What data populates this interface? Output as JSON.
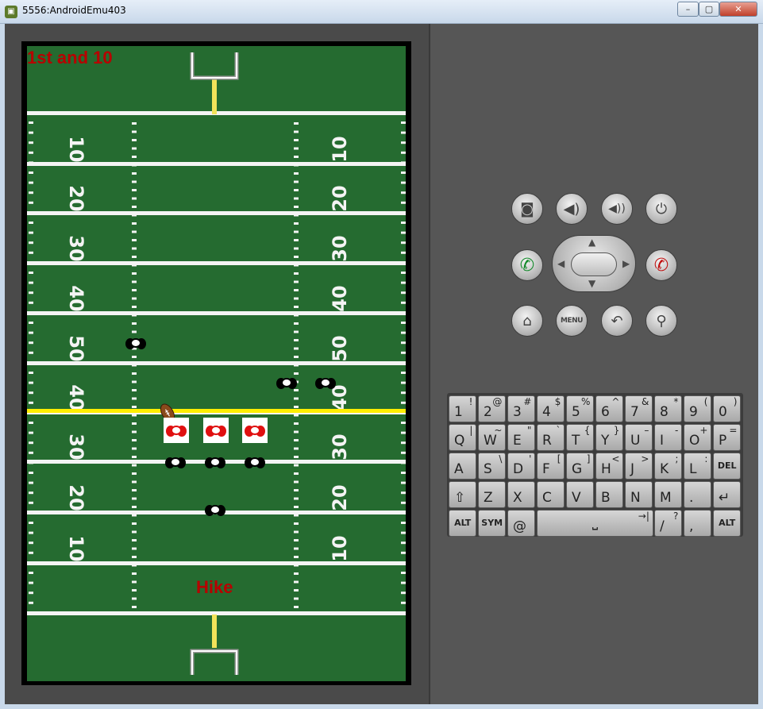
{
  "window": {
    "title": "5556:AndroidEmu403",
    "minimize": "–",
    "maximize": "▢",
    "close": "✕"
  },
  "game": {
    "down_text": "1st and 10",
    "hike_label": "Hike",
    "yard_numbers_left": [
      "10",
      "20",
      "30",
      "40",
      "50",
      "40",
      "30",
      "20",
      "10"
    ],
    "yard_numbers_right": [
      "10",
      "20",
      "30",
      "40",
      "50",
      "40",
      "30",
      "20",
      "10"
    ]
  },
  "hardware": {
    "camera": "camera-icon",
    "volume_down": "volume-down-icon",
    "volume_up": "volume-up-icon",
    "power": "power-icon",
    "call": "call-icon",
    "end_call": "end-call-icon",
    "home": "home-icon",
    "menu_label": "MENU",
    "back": "back-icon",
    "search": "search-icon"
  },
  "keyboard": {
    "rows": [
      [
        [
          "1",
          "!"
        ],
        [
          "2",
          "@"
        ],
        [
          "3",
          "#"
        ],
        [
          "4",
          "$"
        ],
        [
          "5",
          "%"
        ],
        [
          "6",
          "^"
        ],
        [
          "7",
          "&"
        ],
        [
          "8",
          "*"
        ],
        [
          "9",
          "("
        ],
        [
          "0",
          ")"
        ]
      ],
      [
        [
          "Q",
          "|"
        ],
        [
          "W",
          "~"
        ],
        [
          "E",
          "\""
        ],
        [
          "R",
          "`"
        ],
        [
          "T",
          "{"
        ],
        [
          "Y",
          "}"
        ],
        [
          "U",
          "–"
        ],
        [
          "I",
          "-"
        ],
        [
          "O",
          "+"
        ],
        [
          "P",
          "="
        ]
      ],
      [
        [
          "A",
          ""
        ],
        [
          "S",
          "\\"
        ],
        [
          "D",
          "'"
        ],
        [
          "F",
          "["
        ],
        [
          "G",
          "]"
        ],
        [
          "H",
          "<"
        ],
        [
          "J",
          ">"
        ],
        [
          "K",
          ";"
        ],
        [
          "L",
          ":"
        ],
        [
          "DEL",
          ""
        ]
      ],
      [
        [
          "⇧",
          ""
        ],
        [
          "Z",
          ""
        ],
        [
          "X",
          ""
        ],
        [
          "C",
          ""
        ],
        [
          "V",
          ""
        ],
        [
          "B",
          ""
        ],
        [
          "N",
          ""
        ],
        [
          "M",
          ""
        ],
        [
          ".",
          ""
        ],
        [
          "↵",
          ""
        ]
      ]
    ],
    "bottom": {
      "alt_left": "ALT",
      "sym": "SYM",
      "at": "@",
      "space": "⎵",
      "space_alt": "→|",
      "slash": "/",
      "slash_alt": "?",
      "comma": ",",
      "alt_right": "ALT"
    }
  },
  "colors": {
    "field": "#256b30",
    "scrimmage": "#ffee00",
    "hud_text": "#b80000",
    "offense": "#e01010"
  }
}
